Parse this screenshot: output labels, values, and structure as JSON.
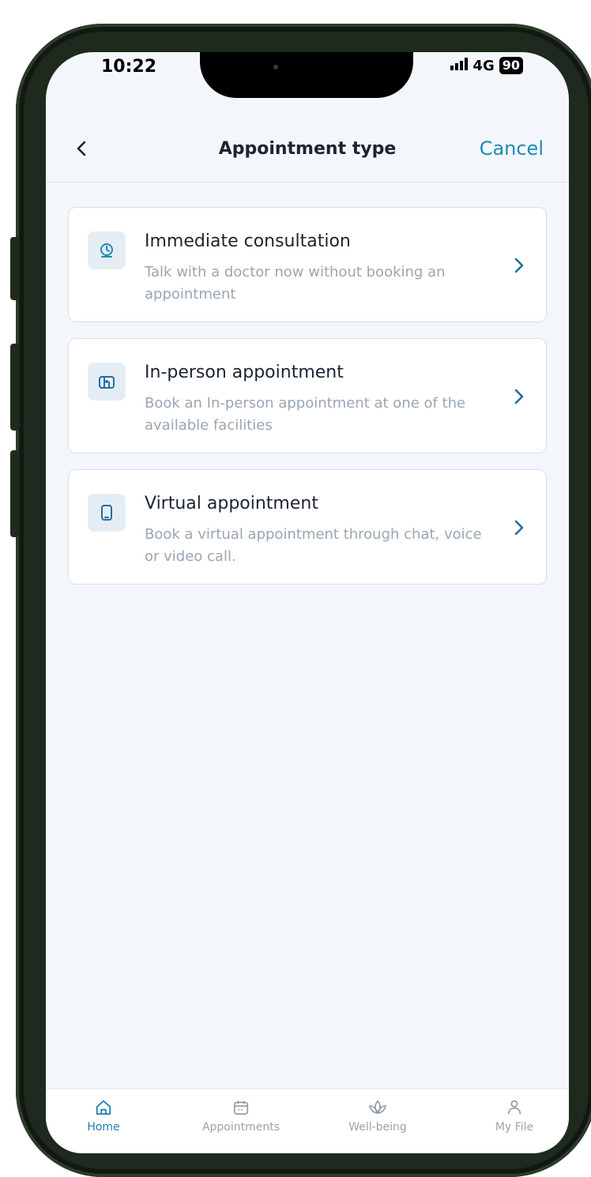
{
  "status_bar": {
    "time": "10:22",
    "network": "4G",
    "battery": "90"
  },
  "header": {
    "title": "Appointment type",
    "cancel_label": "Cancel"
  },
  "options": [
    {
      "title": "Immediate consultation",
      "description": "Talk with a doctor now without booking an appointment",
      "icon": "stethoscope-clock-icon"
    },
    {
      "title": "In-person appointment",
      "description": "Book an In-person appointment at one of the available facilities",
      "icon": "building-icon"
    },
    {
      "title": "Virtual appointment",
      "description": "Book a virtual appointment through chat, voice or video call.",
      "icon": "mobile-phone-icon"
    }
  ],
  "tabs": [
    {
      "label": "Home",
      "icon": "home-icon",
      "active": true
    },
    {
      "label": "Appointments",
      "icon": "calendar-icon",
      "active": false
    },
    {
      "label": "Well-being",
      "icon": "lotus-icon",
      "active": false
    },
    {
      "label": "My File",
      "icon": "person-icon",
      "active": false
    }
  ],
  "colors": {
    "accent": "#1f8bb3",
    "active_tab": "#1f7fae",
    "background": "#f3f6fb"
  }
}
